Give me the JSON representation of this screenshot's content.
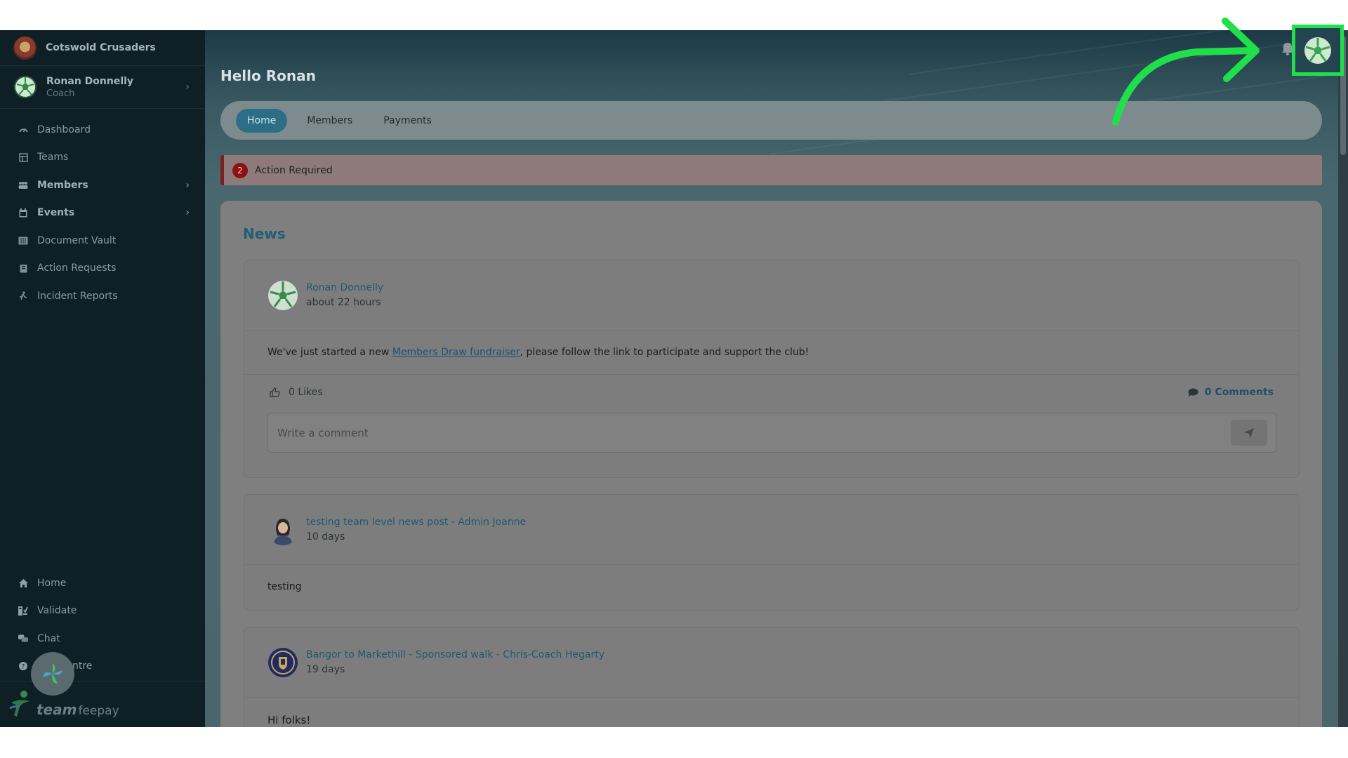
{
  "sidebar": {
    "club_name": "Cotswold Crusaders",
    "user": {
      "name": "Ronan Donnelly",
      "role": "Coach"
    },
    "nav": [
      {
        "label": "Dashboard",
        "icon": "dashboard-icon"
      },
      {
        "label": "Teams",
        "icon": "teams-icon"
      },
      {
        "label": "Members",
        "icon": "members-icon"
      },
      {
        "label": "Events",
        "icon": "calendar-icon"
      },
      {
        "label": "Document Vault",
        "icon": "vault-icon"
      },
      {
        "label": "Action Requests",
        "icon": "clipboard-icon"
      },
      {
        "label": "Incident Reports",
        "icon": "incident-icon"
      }
    ],
    "bottom_nav": [
      {
        "label": "Home",
        "icon": "home-icon"
      },
      {
        "label": "Validate",
        "icon": "validate-icon"
      },
      {
        "label": "Chat",
        "icon": "chat-icon"
      },
      {
        "label": "ntre",
        "icon": "help-icon"
      }
    ],
    "brand": {
      "team": "team",
      "feepay": "feepay"
    }
  },
  "main": {
    "greeting": "Hello Ronan",
    "tabs": [
      {
        "label": "Home",
        "active": true
      },
      {
        "label": "Members",
        "active": false
      },
      {
        "label": "Payments",
        "active": false
      }
    ],
    "alert": {
      "count": "2",
      "text": "Action Required"
    },
    "news": {
      "title": "News",
      "posts": [
        {
          "author": "Ronan Donnelly",
          "time": "about 22 hours",
          "body_before": "We've just started a new ",
          "body_link": "Members Draw fundraiser",
          "body_after": ", please follow the link to participate and support the club!",
          "likes": "0 Likes",
          "comments": "0 Comments",
          "comment_placeholder": "Write a comment"
        },
        {
          "author": "testing team level news post - Admin Joanne",
          "time": "10 days",
          "body": "testing"
        },
        {
          "author": "Bangor to Markethill - Sponsored walk - Chris-Coach Hegarty",
          "time": "19 days",
          "body": "Hi folks!"
        }
      ]
    }
  },
  "colors": {
    "highlight": "#1fe04a",
    "accent": "#2b6e86",
    "alert": "#8a1212"
  }
}
